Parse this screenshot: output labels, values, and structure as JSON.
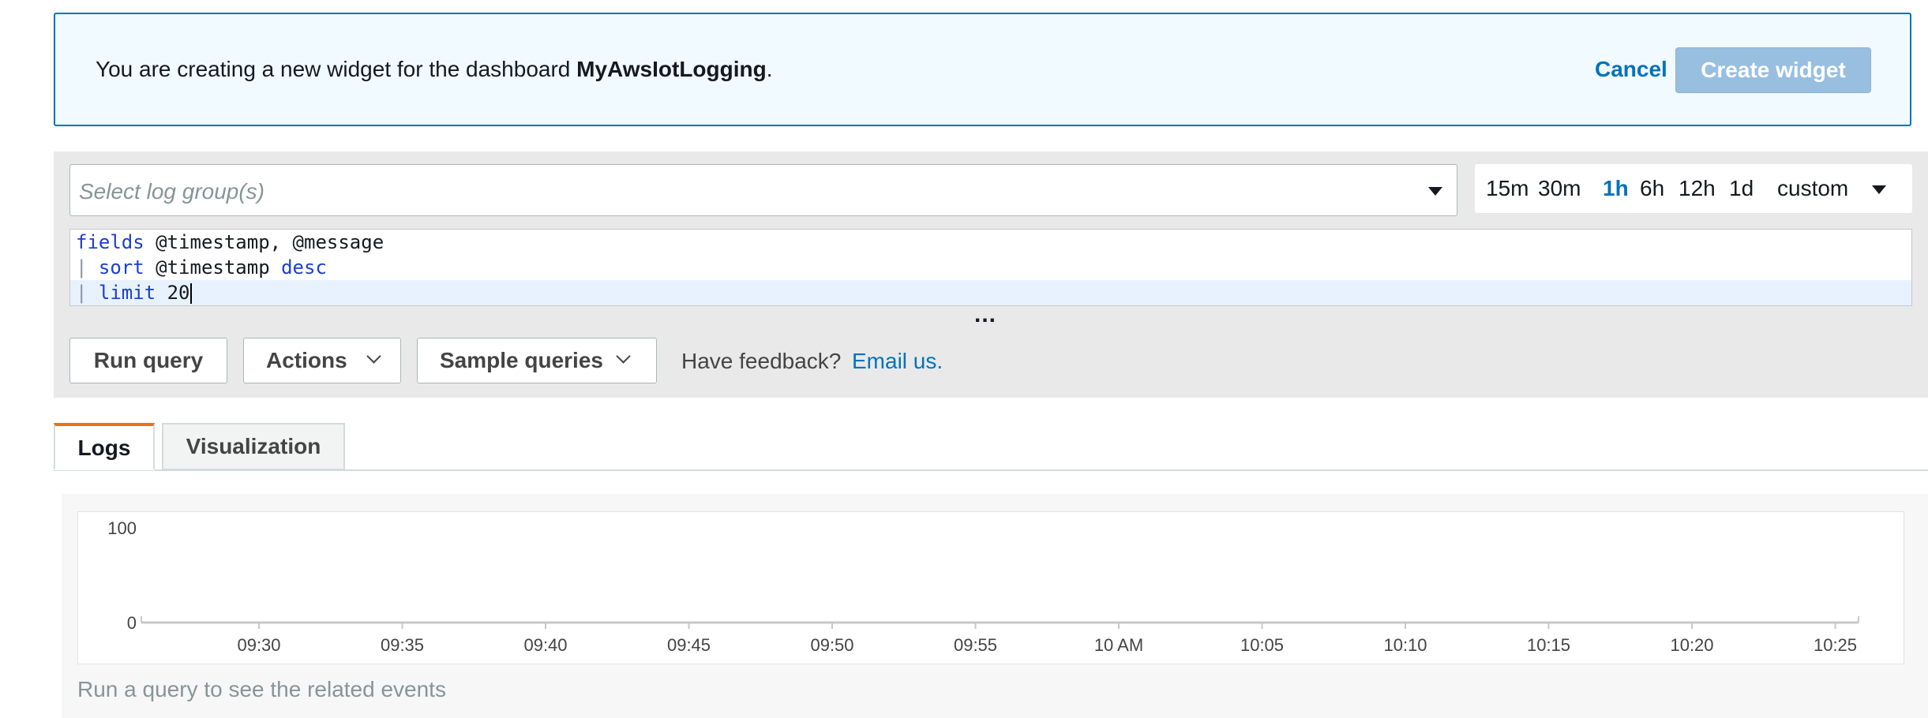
{
  "banner": {
    "message_prefix": "You are creating a new widget for the dashboard",
    "dashboard_name": "MyAwsIotLogging",
    "message_suffix": ".",
    "cancel_label": "Cancel",
    "create_label": "Create widget"
  },
  "query": {
    "log_group_placeholder": "Select log group(s)",
    "time_ranges": [
      "15m",
      "30m",
      "1h",
      "6h",
      "12h",
      "1d",
      "custom"
    ],
    "active_time_range": "1h",
    "lines": [
      [
        {
          "t": "fields",
          "c": "kw"
        },
        {
          "t": " @timestamp, @message",
          "c": "plain"
        }
      ],
      [
        {
          "t": "|",
          "c": "pipe"
        },
        {
          "t": " ",
          "c": "plain"
        },
        {
          "t": "sort",
          "c": "kw"
        },
        {
          "t": " @timestamp ",
          "c": "plain"
        },
        {
          "t": "desc",
          "c": "kw"
        }
      ],
      [
        {
          "t": "|",
          "c": "pipe"
        },
        {
          "t": " ",
          "c": "plain"
        },
        {
          "t": "limit",
          "c": "kw"
        },
        {
          "t": " 20",
          "c": "plain"
        }
      ]
    ],
    "more": "..."
  },
  "buttons": {
    "run": "Run query",
    "actions": "Actions",
    "sample": "Sample queries"
  },
  "feedback": {
    "text": "Have feedback?",
    "link": "Email us."
  },
  "tabs": [
    "Logs",
    "Visualization"
  ],
  "active_tab": "Logs",
  "chart_data": {
    "type": "bar",
    "categories": [
      "09:30",
      "09:35",
      "09:40",
      "09:45",
      "09:50",
      "09:55",
      "10 AM",
      "10:05",
      "10:10",
      "10:15",
      "10:20",
      "10:25"
    ],
    "values": [],
    "yticks": [
      "100",
      "0"
    ],
    "ylim": [
      0,
      100
    ]
  },
  "empty_message": "Run a query to see the related events",
  "colors": {
    "accent": "#0073bb",
    "tab_active": "#ec7211"
  }
}
